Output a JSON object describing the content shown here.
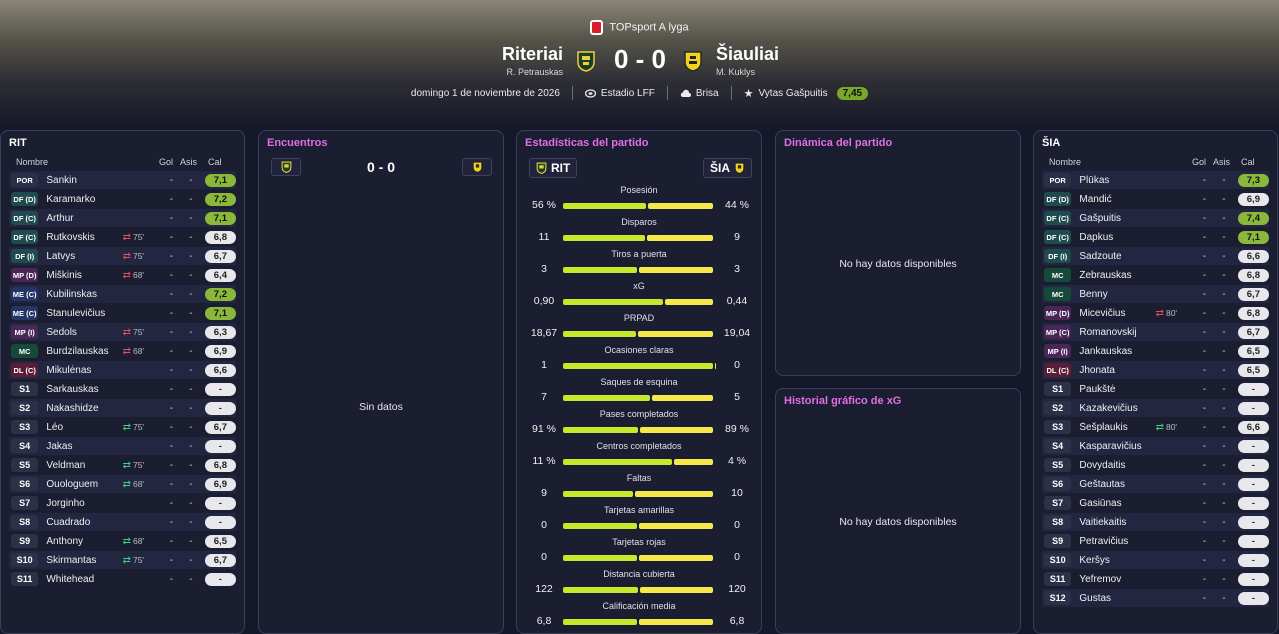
{
  "league": {
    "name": "TOPsport A lyga"
  },
  "match": {
    "home": {
      "name": "Riteriai",
      "coach": "R. Petrauskas",
      "abbr": "RIT"
    },
    "away": {
      "name": "Šiauliai",
      "coach": "M. Kuklys",
      "abbr": "ŠIA"
    },
    "score": "0 - 0",
    "date": "domingo 1 de noviembre de 2026",
    "stadium": "Estadio LFF",
    "weather": "Brisa",
    "potm_name": "Vytas Gašpuitis",
    "potm_rating": "7,45"
  },
  "colors": {
    "accent_pink": "#e06ee6",
    "rating_green": "#8ab83a",
    "home_bar": "#c6e82d",
    "away_bar": "#f5e84a"
  },
  "columns": {
    "name": "Nombre",
    "gol": "Gol",
    "asis": "Asis",
    "cal": "Cal"
  },
  "home_panel": {
    "title": "RIT",
    "players": [
      {
        "pos": "POR",
        "type": "por",
        "name": "Šankin",
        "sub": "",
        "dir": "",
        "gol": "-",
        "asis": "-",
        "cal": "7,1",
        "high": true
      },
      {
        "pos": "DF (D)",
        "type": "df",
        "name": "Karamarko",
        "sub": "",
        "dir": "",
        "gol": "-",
        "asis": "-",
        "cal": "7,2",
        "high": true
      },
      {
        "pos": "DF (C)",
        "type": "df",
        "name": "Arthur",
        "sub": "",
        "dir": "",
        "gol": "-",
        "asis": "-",
        "cal": "7,1",
        "high": true
      },
      {
        "pos": "DF (C)",
        "type": "df",
        "name": "Rutkovskis",
        "sub": "75'",
        "dir": "out",
        "gol": "-",
        "asis": "-",
        "cal": "6,8",
        "high": false
      },
      {
        "pos": "DF (I)",
        "type": "df",
        "name": "Latvys",
        "sub": "75'",
        "dir": "out",
        "gol": "-",
        "asis": "-",
        "cal": "6,7",
        "high": false
      },
      {
        "pos": "MP (D)",
        "type": "mp",
        "name": "Miškinis",
        "sub": "68'",
        "dir": "out",
        "gol": "-",
        "asis": "-",
        "cal": "6,4",
        "high": false
      },
      {
        "pos": "ME (C)",
        "type": "me",
        "name": "Kubilinskas",
        "sub": "",
        "dir": "",
        "gol": "-",
        "asis": "-",
        "cal": "7,2",
        "high": true
      },
      {
        "pos": "ME (C)",
        "type": "me",
        "name": "Stanulevičius",
        "sub": "",
        "dir": "",
        "gol": "-",
        "asis": "-",
        "cal": "7,1",
        "high": true
      },
      {
        "pos": "MP (I)",
        "type": "mp",
        "name": "Sedols",
        "sub": "75'",
        "dir": "out",
        "gol": "-",
        "asis": "-",
        "cal": "6,3",
        "high": false
      },
      {
        "pos": "MC",
        "type": "mc",
        "name": "Burdzilauskas",
        "sub": "68'",
        "dir": "out",
        "gol": "-",
        "asis": "-",
        "cal": "6,9",
        "high": false
      },
      {
        "pos": "DL (C)",
        "type": "dl",
        "name": "Mikulėnas",
        "sub": "",
        "dir": "",
        "gol": "-",
        "asis": "-",
        "cal": "6,6",
        "high": false
      },
      {
        "pos": "S1",
        "type": "s",
        "name": "Šarkauskas",
        "sub": "",
        "dir": "",
        "gol": "-",
        "asis": "-",
        "cal": "-",
        "high": false
      },
      {
        "pos": "S2",
        "type": "s",
        "name": "Nakashidze",
        "sub": "",
        "dir": "",
        "gol": "-",
        "asis": "-",
        "cal": "-",
        "high": false
      },
      {
        "pos": "S3",
        "type": "s",
        "name": "Léo",
        "sub": "75'",
        "dir": "in",
        "gol": "-",
        "asis": "-",
        "cal": "6,7",
        "high": false
      },
      {
        "pos": "S4",
        "type": "s",
        "name": "Jakas",
        "sub": "",
        "dir": "",
        "gol": "-",
        "asis": "-",
        "cal": "-",
        "high": false
      },
      {
        "pos": "S5",
        "type": "s",
        "name": "Veldman",
        "sub": "75'",
        "dir": "in",
        "gol": "-",
        "asis": "-",
        "cal": "6,8",
        "high": false
      },
      {
        "pos": "S6",
        "type": "s",
        "name": "Ouologuem",
        "sub": "68'",
        "dir": "in",
        "gol": "-",
        "asis": "-",
        "cal": "6,9",
        "high": false
      },
      {
        "pos": "S7",
        "type": "s",
        "name": "Jorginho",
        "sub": "",
        "dir": "",
        "gol": "-",
        "asis": "-",
        "cal": "-",
        "high": false
      },
      {
        "pos": "S8",
        "type": "s",
        "name": "Cuadrado",
        "sub": "",
        "dir": "",
        "gol": "-",
        "asis": "-",
        "cal": "-",
        "high": false
      },
      {
        "pos": "S9",
        "type": "s",
        "name": "Anthony",
        "sub": "68'",
        "dir": "in",
        "gol": "-",
        "asis": "-",
        "cal": "6,5",
        "high": false
      },
      {
        "pos": "S10",
        "type": "s",
        "name": "Skirmantas",
        "sub": "75'",
        "dir": "in",
        "gol": "-",
        "asis": "-",
        "cal": "6,7",
        "high": false
      },
      {
        "pos": "S11",
        "type": "s",
        "name": "Whitehead",
        "sub": "",
        "dir": "",
        "gol": "-",
        "asis": "-",
        "cal": "-",
        "high": false
      }
    ]
  },
  "away_panel": {
    "title": "ŠIA",
    "players": [
      {
        "pos": "POR",
        "type": "por",
        "name": "Plūkas",
        "sub": "",
        "dir": "",
        "gol": "-",
        "asis": "-",
        "cal": "7,3",
        "high": true
      },
      {
        "pos": "DF (D)",
        "type": "df",
        "name": "Mandić",
        "sub": "",
        "dir": "",
        "gol": "-",
        "asis": "-",
        "cal": "6,9",
        "high": false
      },
      {
        "pos": "DF (C)",
        "type": "df",
        "name": "Gašpuitis",
        "sub": "",
        "dir": "",
        "gol": "-",
        "asis": "-",
        "cal": "7,4",
        "high": true
      },
      {
        "pos": "DF (C)",
        "type": "df",
        "name": "Dapkus",
        "sub": "",
        "dir": "",
        "gol": "-",
        "asis": "-",
        "cal": "7,1",
        "high": true
      },
      {
        "pos": "DF (I)",
        "type": "df",
        "name": "Sadzoute",
        "sub": "",
        "dir": "",
        "gol": "-",
        "asis": "-",
        "cal": "6,6",
        "high": false
      },
      {
        "pos": "MC",
        "type": "mc",
        "name": "Žebrauskas",
        "sub": "",
        "dir": "",
        "gol": "-",
        "asis": "-",
        "cal": "6,8",
        "high": false
      },
      {
        "pos": "MC",
        "type": "mc",
        "name": "Benny",
        "sub": "",
        "dir": "",
        "gol": "-",
        "asis": "-",
        "cal": "6,7",
        "high": false
      },
      {
        "pos": "MP (D)",
        "type": "mp",
        "name": "Micevičius",
        "sub": "80'",
        "dir": "out",
        "gol": "-",
        "asis": "-",
        "cal": "6,8",
        "high": false
      },
      {
        "pos": "MP (C)",
        "type": "mp",
        "name": "Romanovskij",
        "sub": "",
        "dir": "",
        "gol": "-",
        "asis": "-",
        "cal": "6,7",
        "high": false
      },
      {
        "pos": "MP (I)",
        "type": "mp",
        "name": "Jankauskas",
        "sub": "",
        "dir": "",
        "gol": "-",
        "asis": "-",
        "cal": "6,5",
        "high": false
      },
      {
        "pos": "DL (C)",
        "type": "dl",
        "name": "Jhonata",
        "sub": "",
        "dir": "",
        "gol": "-",
        "asis": "-",
        "cal": "6,5",
        "high": false
      },
      {
        "pos": "S1",
        "type": "s",
        "name": "Paukštė",
        "sub": "",
        "dir": "",
        "gol": "-",
        "asis": "-",
        "cal": "-",
        "high": false
      },
      {
        "pos": "S2",
        "type": "s",
        "name": "Kazakevičius",
        "sub": "",
        "dir": "",
        "gol": "-",
        "asis": "-",
        "cal": "-",
        "high": false
      },
      {
        "pos": "S3",
        "type": "s",
        "name": "Šešplaukis",
        "sub": "80'",
        "dir": "in",
        "gol": "-",
        "asis": "-",
        "cal": "6,6",
        "high": false
      },
      {
        "pos": "S4",
        "type": "s",
        "name": "Kasparavičius",
        "sub": "",
        "dir": "",
        "gol": "-",
        "asis": "-",
        "cal": "-",
        "high": false
      },
      {
        "pos": "S5",
        "type": "s",
        "name": "Dovydaitis",
        "sub": "",
        "dir": "",
        "gol": "-",
        "asis": "-",
        "cal": "-",
        "high": false
      },
      {
        "pos": "S6",
        "type": "s",
        "name": "Geštautas",
        "sub": "",
        "dir": "",
        "gol": "-",
        "asis": "-",
        "cal": "-",
        "high": false
      },
      {
        "pos": "S7",
        "type": "s",
        "name": "Gasiūnas",
        "sub": "",
        "dir": "",
        "gol": "-",
        "asis": "-",
        "cal": "-",
        "high": false
      },
      {
        "pos": "S8",
        "type": "s",
        "name": "Vaitiekaitis",
        "sub": "",
        "dir": "",
        "gol": "-",
        "asis": "-",
        "cal": "-",
        "high": false
      },
      {
        "pos": "S9",
        "type": "s",
        "name": "Petravičius",
        "sub": "",
        "dir": "",
        "gol": "-",
        "asis": "-",
        "cal": "-",
        "high": false
      },
      {
        "pos": "S10",
        "type": "s",
        "name": "Keršys",
        "sub": "",
        "dir": "",
        "gol": "-",
        "asis": "-",
        "cal": "-",
        "high": false
      },
      {
        "pos": "S11",
        "type": "s",
        "name": "Yefremov",
        "sub": "",
        "dir": "",
        "gol": "-",
        "asis": "-",
        "cal": "-",
        "high": false
      },
      {
        "pos": "S12",
        "type": "s",
        "name": "Gustas",
        "sub": "",
        "dir": "",
        "gol": "-",
        "asis": "-",
        "cal": "-",
        "high": false
      }
    ]
  },
  "encuentros": {
    "title": "Encuentros",
    "score": "0 - 0",
    "empty": "Sin datos"
  },
  "stats": {
    "title": "Estadísticas del partido",
    "rows": [
      {
        "label": "Posesión",
        "home": "56 %",
        "away": "44 %",
        "hv": 56,
        "av": 44
      },
      {
        "label": "Disparos",
        "home": "11",
        "away": "9",
        "hv": 11,
        "av": 9
      },
      {
        "label": "Tiros a puerta",
        "home": "3",
        "away": "3",
        "hv": 3,
        "av": 3
      },
      {
        "label": "xG",
        "home": "0,90",
        "away": "0,44",
        "hv": 0.9,
        "av": 0.44
      },
      {
        "label": "PRPAD",
        "home": "18,67",
        "away": "19,04",
        "hv": 18.67,
        "av": 19.04
      },
      {
        "label": "Ocasiones claras",
        "home": "1",
        "away": "0",
        "hv": 1,
        "av": 0
      },
      {
        "label": "Saques de esquina",
        "home": "7",
        "away": "5",
        "hv": 7,
        "av": 5
      },
      {
        "label": "Pases completados",
        "home": "91 %",
        "away": "89 %",
        "hv": 91,
        "av": 89
      },
      {
        "label": "Centros completados",
        "home": "11 %",
        "away": "4 %",
        "hv": 11,
        "av": 4
      },
      {
        "label": "Faltas",
        "home": "9",
        "away": "10",
        "hv": 9,
        "av": 10
      },
      {
        "label": "Tarjetas amarillas",
        "home": "0",
        "away": "0",
        "hv": 0,
        "av": 0
      },
      {
        "label": "Tarjetas rojas",
        "home": "0",
        "away": "0",
        "hv": 0,
        "av": 0
      },
      {
        "label": "Distancia cubierta",
        "home": "122",
        "away": "120",
        "hv": 122,
        "av": 120
      },
      {
        "label": "Calificación media",
        "home": "6,8",
        "away": "6,8",
        "hv": 6.8,
        "av": 6.8
      }
    ]
  },
  "dinamica": {
    "title": "Dinámica del partido",
    "empty": "No hay datos disponibles"
  },
  "xg_history": {
    "title": "Historial gráfico de xG",
    "empty": "No hay datos disponibles"
  }
}
